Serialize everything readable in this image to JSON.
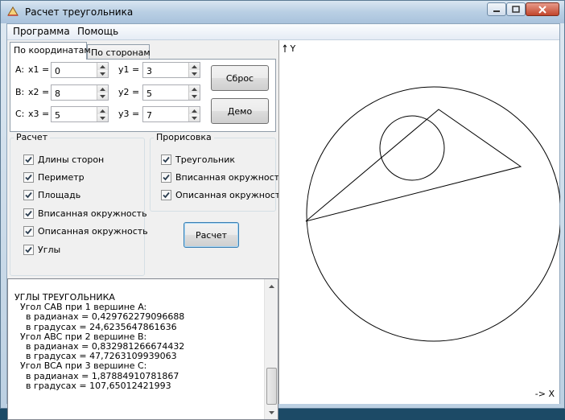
{
  "window": {
    "title": "Расчет треугольника"
  },
  "menu": [
    "Программа",
    "Помощь"
  ],
  "tabs": {
    "active": "По координатам",
    "inactive": "По сторонам"
  },
  "coords": {
    "rows": [
      {
        "label": "A:",
        "xname": "x1 =",
        "x": "0",
        "yname": "y1 =",
        "y": "3"
      },
      {
        "label": "B:",
        "xname": "x2 =",
        "x": "8",
        "yname": "y2 =",
        "y": "5"
      },
      {
        "label": "C:",
        "xname": "x3 =",
        "x": "5",
        "yname": "y3 =",
        "y": "7"
      }
    ]
  },
  "buttons": {
    "reset": "Сброс",
    "demo": "Демо",
    "calculate": "Расчет"
  },
  "calc_group": {
    "title": "Расчет",
    "items": [
      {
        "label": "Длины сторон",
        "checked": true
      },
      {
        "label": "Периметр",
        "checked": true
      },
      {
        "label": "Площадь",
        "checked": true
      },
      {
        "label": "Вписанная окружность",
        "checked": true
      },
      {
        "label": "Описанная окружность",
        "checked": true
      },
      {
        "label": "Углы",
        "checked": true
      }
    ]
  },
  "draw_group": {
    "title": "Прорисовка",
    "items": [
      {
        "label": "Треугольник",
        "checked": true
      },
      {
        "label": "Вписанная окружность",
        "checked": true
      },
      {
        "label": "Описанная окружность",
        "checked": true
      }
    ]
  },
  "output": {
    "lines": [
      "УГЛЫ ТРЕУГОЛЬНИКА",
      "  Угол CAB при 1 вершине A:",
      "    в радианах = 0,429762279096688",
      "    в градусах = 24,6235647861636",
      "  Угол ABC при 2 вершине B:",
      "    в радианах = 0,832981266674432",
      "    в градусах = 47,7263109939063",
      "  Угол BCA при 3 вершине C:",
      "    в радианах = 1,87884910781867",
      "    в градусах = 107,65012421993"
    ]
  },
  "canvas": {
    "y_axis_label": "Y",
    "x_axis_label": "-> X"
  },
  "colors": {
    "titlebar": "#b9cfe4",
    "client_bg": "#f0f0f0",
    "canvas_bg": "#ffffff",
    "focus_border": "#3c7fb1"
  }
}
